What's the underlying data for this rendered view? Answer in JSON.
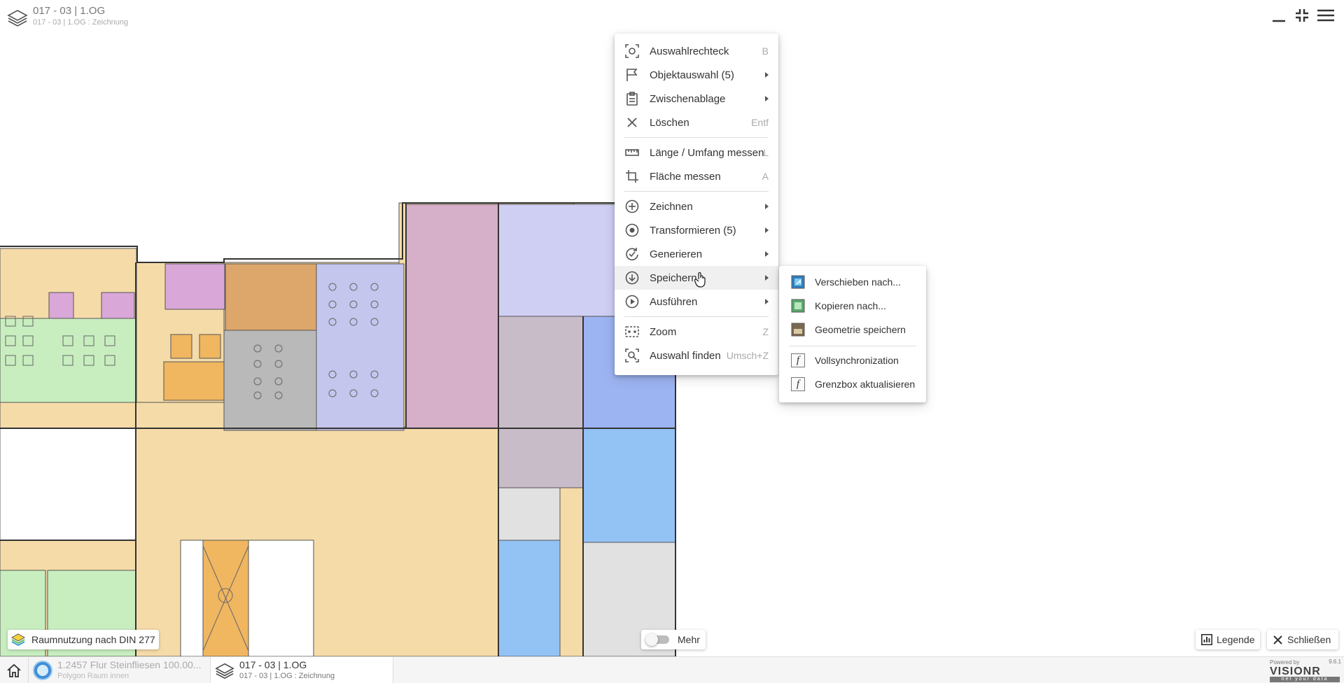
{
  "header": {
    "title": "017 - 03 | 1.OG",
    "subtitle": "017 - 03 | 1.OG : Zeichnung"
  },
  "context_menu": {
    "items": [
      {
        "label": "Auswahlrechteck",
        "shortcut": "B",
        "icon": "selection-rectangle-icon"
      },
      {
        "label": "Objektauswahl (5)",
        "submenu": true,
        "icon": "flag-icon"
      },
      {
        "label": "Zwischenablage",
        "submenu": true,
        "icon": "clipboard-icon"
      },
      {
        "label": "Löschen",
        "shortcut": "Entf",
        "icon": "close-icon"
      },
      {
        "label": "Länge / Umfang messen",
        "shortcut": "L",
        "icon": "ruler-icon"
      },
      {
        "label": "Fläche messen",
        "shortcut": "A",
        "icon": "crop-icon"
      },
      {
        "label": "Zeichnen",
        "submenu": true,
        "icon": "plus-circle-icon"
      },
      {
        "label": "Transformieren (5)",
        "submenu": true,
        "icon": "radio-circle-icon"
      },
      {
        "label": "Generieren",
        "submenu": true,
        "icon": "refresh-check-icon"
      },
      {
        "label": "Speichern",
        "submenu": true,
        "icon": "download-circle-icon",
        "highlighted": true
      },
      {
        "label": "Ausführen",
        "submenu": true,
        "icon": "play-circle-icon"
      },
      {
        "label": "Zoom",
        "shortcut": "Z",
        "icon": "zoom-frame-icon"
      },
      {
        "label": "Auswahl finden",
        "shortcut": "Umsch+Z",
        "icon": "find-selection-icon"
      }
    ]
  },
  "submenu": {
    "items": [
      {
        "label": "Verschieben nach...",
        "icon": "move-layer-icon"
      },
      {
        "label": "Kopieren nach...",
        "icon": "copy-layer-icon"
      },
      {
        "label": "Geometrie speichern",
        "icon": "save-geometry-icon"
      },
      {
        "label": "Vollsynchronization",
        "icon": "function-icon"
      },
      {
        "label": "Grenzbox aktualisieren",
        "icon": "function-icon"
      }
    ]
  },
  "overlay": {
    "raumnutzung_label": "Raumnutzung nach DIN 277",
    "mehr_label": "Mehr",
    "mehr_toggle_on": false,
    "legende_label": "Legende",
    "schliessen_label": "Schließen"
  },
  "bottom_bar": {
    "object_title": "1.2457 Flur Steinfliesen 100.00...",
    "object_subtitle": "Polygon Raum innen",
    "layer_title": "017 - 03 | 1.OG",
    "layer_subtitle": "017 - 03 | 1.OG : Zeichnung"
  },
  "brand": {
    "powered_by": "Powered by",
    "name": "VISIONR",
    "version": "9.6.1",
    "tagline": "net your data"
  },
  "colors": {
    "corridor": "#f5dba8",
    "green_room": "#c8eec0",
    "magenta_room": "#d9a7d8",
    "orange_room": "#dda66a",
    "gray_room": "#b9b9b9",
    "lavender_room": "#c5c6ee",
    "pink_room": "#d6afc8",
    "blue_room": "#93c2f5",
    "light_gray_room": "#e1e1e1",
    "stair_orange": "#f0b660"
  }
}
